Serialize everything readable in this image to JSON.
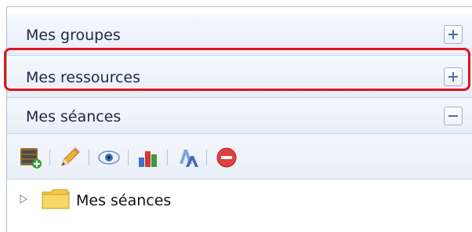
{
  "accordion": {
    "sections": [
      {
        "label": "Mes groupes",
        "toggle": "plus"
      },
      {
        "label": "Mes ressources",
        "toggle": "plus"
      },
      {
        "label": "Mes séances",
        "toggle": "minus"
      }
    ]
  },
  "toolbar": {
    "icons": [
      "new-session-icon",
      "edit-pencil-icon",
      "view-eye-icon",
      "statistics-chart-icon",
      "spellcheck-icon",
      "delete-icon"
    ]
  },
  "tree": {
    "nodes": [
      {
        "label": "Mes séances",
        "icon": "folder-icon"
      }
    ]
  },
  "colors": {
    "highlight": "#e0141b",
    "header_text": "#1c2a44"
  }
}
